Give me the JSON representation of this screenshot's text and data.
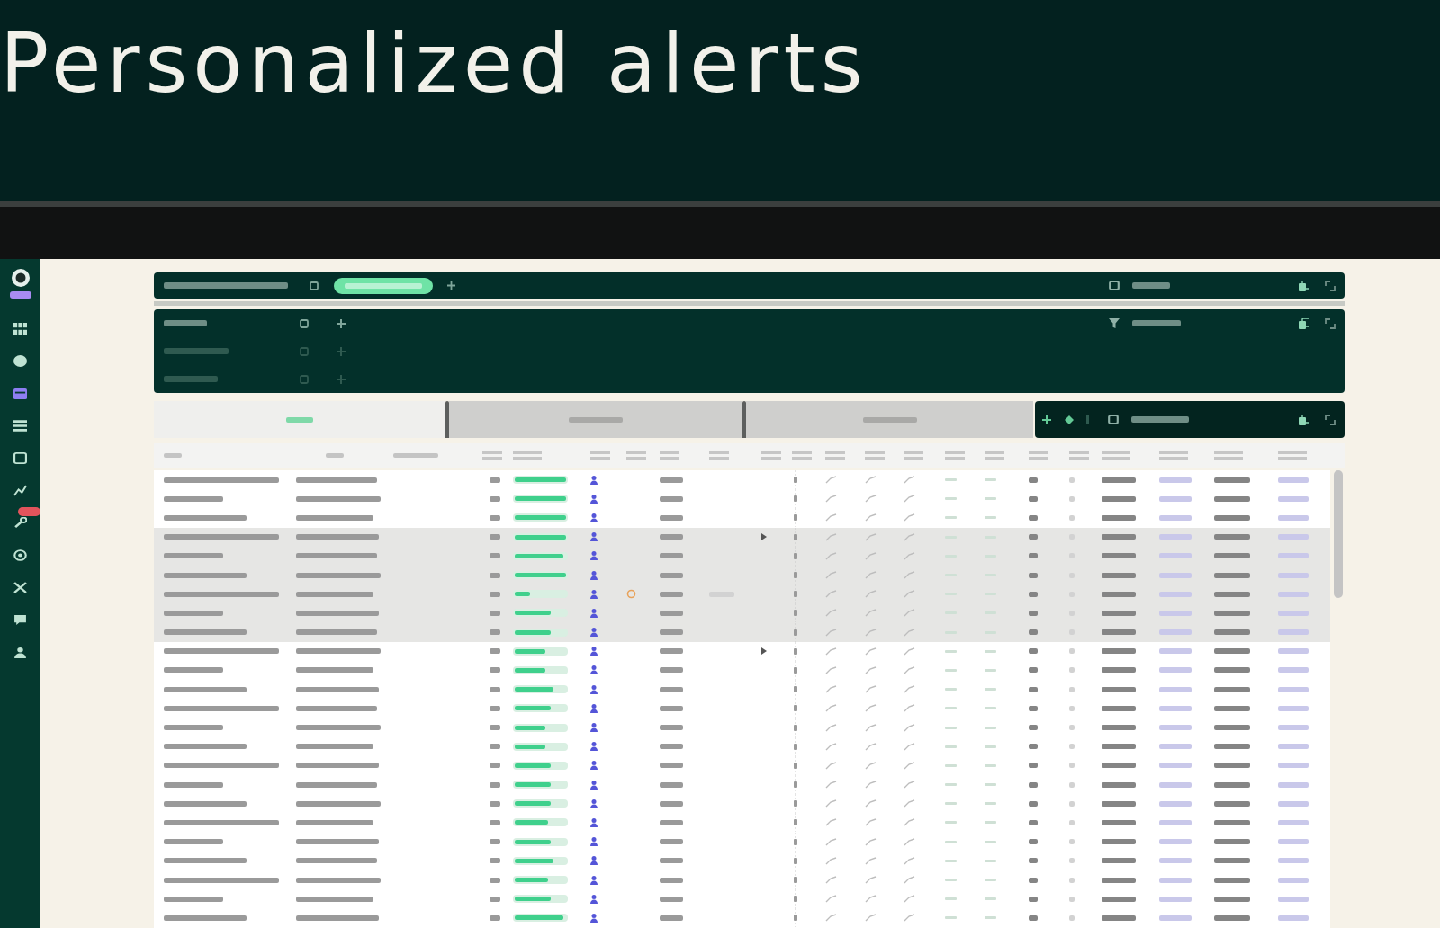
{
  "slide": {
    "title": "Personalized alerts"
  },
  "sidebar": {
    "items": [
      {
        "selected": false,
        "badge": false
      },
      {
        "selected": false,
        "badge": false
      },
      {
        "selected": true,
        "badge": false
      },
      {
        "selected": false,
        "badge": false
      },
      {
        "selected": false,
        "badge": false
      },
      {
        "selected": false,
        "badge": false
      },
      {
        "selected": false,
        "badge": true
      },
      {
        "selected": false,
        "badge": false
      },
      {
        "selected": false,
        "badge": false
      },
      {
        "selected": false,
        "badge": false
      },
      {
        "selected": false,
        "badge": false
      }
    ]
  },
  "filter_panel": {
    "rows": [
      {
        "disabled": false
      },
      {
        "disabled": true
      },
      {
        "disabled": true
      }
    ]
  },
  "tabs": [
    {
      "selected": true
    },
    {
      "selected": false
    },
    {
      "selected": false
    }
  ],
  "table": {
    "rows": [
      {
        "selected": false,
        "level": 1,
        "expandable": false,
        "kind": "standard"
      },
      {
        "selected": false,
        "level": 1,
        "expandable": false,
        "kind": "standard"
      },
      {
        "selected": false,
        "level": 1,
        "expandable": false,
        "kind": "standard"
      },
      {
        "selected": true,
        "level": 1,
        "expandable": true,
        "kind": "standard"
      },
      {
        "selected": true,
        "level": 0.95,
        "expandable": false,
        "kind": "standard"
      },
      {
        "selected": true,
        "level": 1,
        "expandable": false,
        "kind": "standard"
      },
      {
        "selected": true,
        "level": 0.3,
        "expandable": false,
        "kind": "warning"
      },
      {
        "selected": true,
        "level": 0.7,
        "expandable": false,
        "kind": "standard"
      },
      {
        "selected": true,
        "level": 0.7,
        "expandable": false,
        "kind": "standard"
      },
      {
        "selected": false,
        "level": 0.6,
        "expandable": true,
        "kind": "standard"
      },
      {
        "selected": false,
        "level": 0.6,
        "expandable": false,
        "kind": "standard"
      },
      {
        "selected": false,
        "level": 0.75,
        "expandable": false,
        "kind": "standard"
      },
      {
        "selected": false,
        "level": 0.7,
        "expandable": false,
        "kind": "standard"
      },
      {
        "selected": false,
        "level": 0.6,
        "expandable": false,
        "kind": "standard"
      },
      {
        "selected": false,
        "level": 0.6,
        "expandable": false,
        "kind": "standard"
      },
      {
        "selected": false,
        "level": 0.7,
        "expandable": false,
        "kind": "standard"
      },
      {
        "selected": false,
        "level": 0.7,
        "expandable": false,
        "kind": "standard"
      },
      {
        "selected": false,
        "level": 0.7,
        "expandable": false,
        "kind": "standard"
      },
      {
        "selected": false,
        "level": 0.65,
        "expandable": false,
        "kind": "standard"
      },
      {
        "selected": false,
        "level": 0.7,
        "expandable": false,
        "kind": "standard"
      },
      {
        "selected": false,
        "level": 0.75,
        "expandable": false,
        "kind": "standard"
      },
      {
        "selected": false,
        "level": 0.65,
        "expandable": false,
        "kind": "standard"
      },
      {
        "selected": false,
        "level": 0.7,
        "expandable": false,
        "kind": "standard"
      },
      {
        "selected": false,
        "level": 0.95,
        "expandable": false,
        "kind": "standard"
      }
    ]
  }
}
